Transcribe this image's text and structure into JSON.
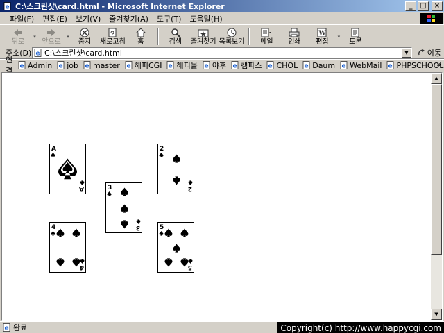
{
  "window": {
    "title": "C:\\스크린샷\\card.html - Microsoft Internet Explorer",
    "buttons": {
      "minimize": "_",
      "maximize": "□",
      "close": "×"
    }
  },
  "menu": [
    "파일(F)",
    "편집(E)",
    "보기(V)",
    "즐겨찾기(A)",
    "도구(T)",
    "도움말(H)"
  ],
  "toolbar": {
    "back": "뒤로",
    "forward": "앞으로",
    "stop": "중지",
    "refresh": "새로고침",
    "home": "홈",
    "search": "검색",
    "favorites": "즐겨찾기",
    "history": "목록보기",
    "mail": "메일",
    "print": "인쇄",
    "edit": "편집",
    "discuss": "토론"
  },
  "address": {
    "label": "주소(D)",
    "url": "C:\\스크린샷\\card.html",
    "go": "이동"
  },
  "links": {
    "label": "연결",
    "items": [
      "Admin",
      "job",
      "master",
      "해피CGI",
      "해피몰",
      "야후",
      "캠파스",
      "CHOL",
      "Daum",
      "WebMail",
      "PHPSCHOOL"
    ],
    "more": "»"
  },
  "cards": [
    {
      "rank": "A",
      "suit": "spade"
    },
    {
      "rank": "2",
      "suit": "spade"
    },
    {
      "rank": "3",
      "suit": "spade"
    },
    {
      "rank": "4",
      "suit": "spade"
    },
    {
      "rank": "5",
      "suit": "spade"
    }
  ],
  "status": {
    "text": "완료",
    "copyright": "Copyright(c) http://www.happycgi.com"
  },
  "colors": {
    "titlebar_start": "#0a246a",
    "titlebar_end": "#a6caf0",
    "chrome": "#d4d0c8"
  }
}
